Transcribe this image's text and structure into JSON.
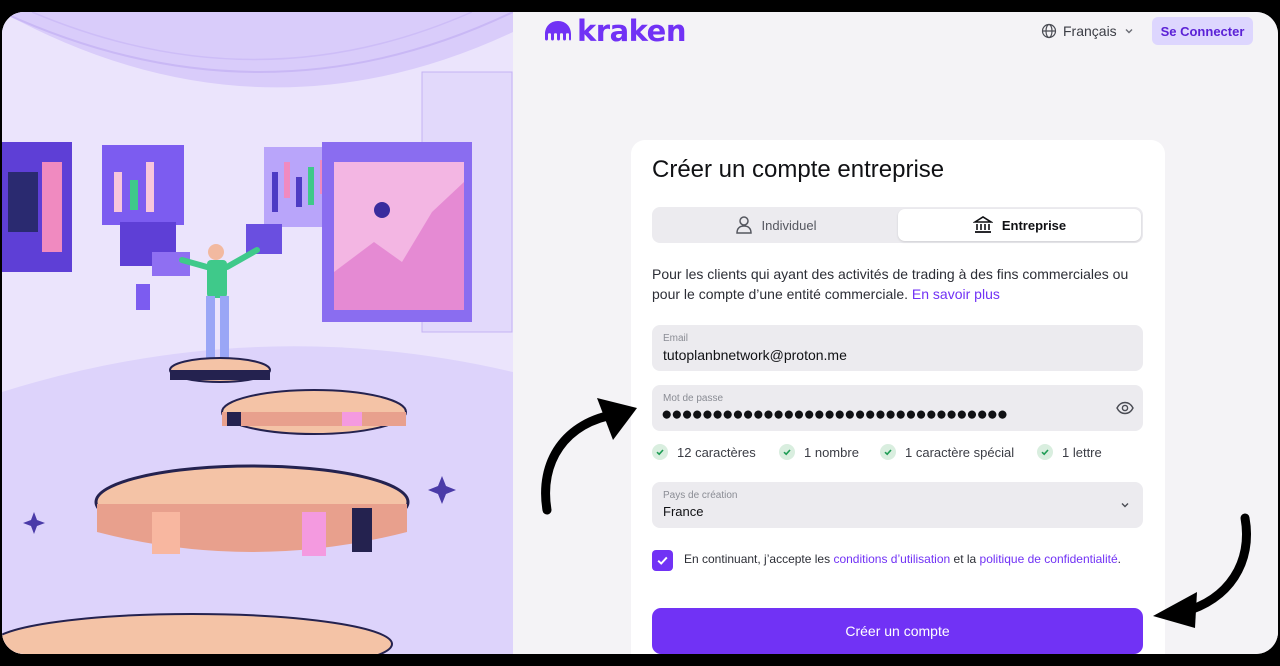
{
  "brand": {
    "logo_text": "kraken",
    "color": "#7132f5"
  },
  "header": {
    "language": "Français",
    "signin_label": "Se Connecter"
  },
  "form": {
    "title": "Créer un compte entreprise",
    "tabs": [
      {
        "label": "Individuel",
        "icon": "person-icon",
        "active": false
      },
      {
        "label": "Entreprise",
        "icon": "bank-building-icon",
        "active": true
      }
    ],
    "description": "Pour les clients qui ayant des activités de trading à des fins commerciales ou pour le compte d’une entité commerciale.",
    "learn_more": "En savoir plus",
    "email": {
      "label": "Email",
      "value": "tutoplanbnetwork@proton.me"
    },
    "password": {
      "label": "Mot de passe",
      "value": "●●●●●●●●●●●●●●●●●●●●●●●●●●●●●●●●●●"
    },
    "requirements": [
      {
        "label": "12 caractères",
        "met": true
      },
      {
        "label": "1 nombre",
        "met": true
      },
      {
        "label": "1 caractère spécial",
        "met": true
      },
      {
        "label": "1 lettre",
        "met": true
      }
    ],
    "country": {
      "label": "Pays de création",
      "value": "France"
    },
    "consent": {
      "checked": true,
      "text_before": "En continuant, j’accepte les ",
      "terms_link": "conditions d’utilisation",
      "text_middle": " et la ",
      "privacy_link": "politique de confidentialité",
      "text_after": "."
    },
    "submit_label": "Créer un compte"
  },
  "colors": {
    "accent": "#7132f5",
    "check_bg": "#d9eedf",
    "check_fg": "#1f9d55",
    "illustration_bg": "#e9e2fb"
  }
}
